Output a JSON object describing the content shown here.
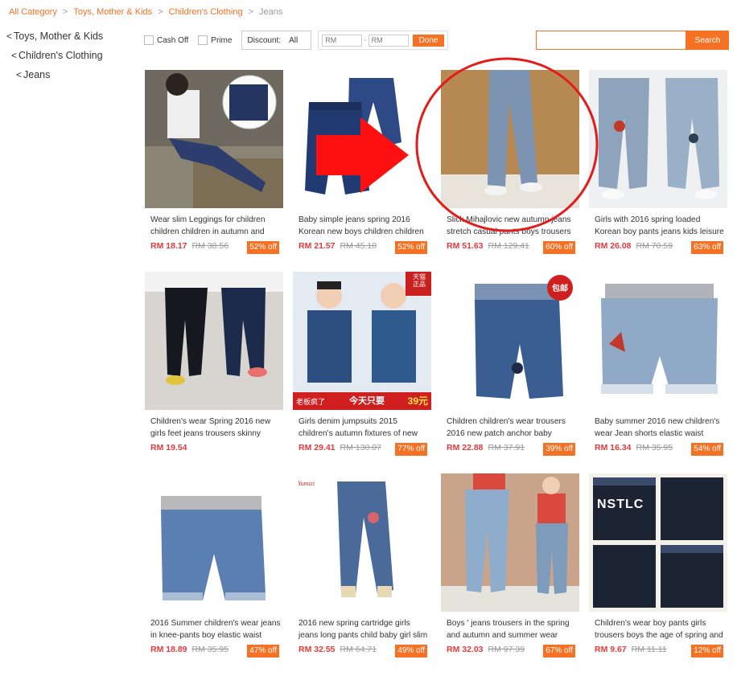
{
  "breadcrumb": [
    {
      "label": "All Category",
      "link": true
    },
    {
      "label": "Toys, Mother & Kids",
      "link": true
    },
    {
      "label": "Children's Clothing",
      "link": true
    },
    {
      "label": "Jeans",
      "link": false
    }
  ],
  "breadcrumb_sep": ">",
  "categories": [
    {
      "label": "Toys, Mother & Kids",
      "chevron": "<"
    },
    {
      "label": "Children's Clothing",
      "chevron": "<"
    },
    {
      "label": "Jeans",
      "chevron": "<"
    }
  ],
  "filters": {
    "cash_off_label": "Cash Off",
    "prime_label": "Prime",
    "discount_label": "Discount:",
    "discount_value": "All",
    "min_placeholder": "RM",
    "max_placeholder": "RM",
    "range_dash": "-",
    "done_label": "Done"
  },
  "search": {
    "placeholder": "",
    "button_label": "Search"
  },
  "accent_color": "#f57224",
  "price_color": "#e4393c",
  "products": [
    {
      "title": "Wear slim Leggings for children children children in autumn and",
      "price": "RM 18.17",
      "old_price": "RM 38.56",
      "discount": "52% off",
      "image": "girl-jeans-photo"
    },
    {
      "title": "Baby simple jeans spring 2016 Korean new boys children children",
      "price": "RM 21.57",
      "old_price": "RM 45.10",
      "discount": "52% off",
      "image": "baby-jeans-photo"
    },
    {
      "title": "Slick Mihajlovic new autumn jeans stretch casual pants boys trousers",
      "price": "RM 51.63",
      "old_price": "RM 129.41",
      "discount": "60% off",
      "image": "slim-jeans-photo"
    },
    {
      "title": "Girls with 2016 spring loaded Korean boy pants jeans kids leisure",
      "price": "RM 26.08",
      "old_price": "RM 70.59",
      "discount": "63% off",
      "image": "patch-jeans-photo"
    },
    {
      "title": "Children's wear Spring 2016 new girls feet jeans trousers skinny",
      "price": "RM 19.54",
      "old_price": "",
      "discount": "",
      "image": "dark-jeans-photo"
    },
    {
      "title": "Girls denim jumpsuits 2015 children's autumn fixtures of new",
      "price": "RM 29.41",
      "old_price": "RM 130.07",
      "discount": "77% off",
      "image": "denim-jumpsuit-photo",
      "badge_top": "天猫正品",
      "banner_left": "老板疯了",
      "banner_right": "今天只要",
      "banner_price": "39元"
    },
    {
      "title": "Children children's wear trousers 2016 new patch anchor baby",
      "price": "RM 22.88",
      "old_price": "RM 37.91",
      "discount": "39% off",
      "image": "anchor-jeans-photo",
      "sticker": "包邮"
    },
    {
      "title": "Baby summer 2016 new children's wear Jean shorts elastic waist",
      "price": "RM 16.34",
      "old_price": "RM 35.95",
      "discount": "54% off",
      "image": "jean-shorts-photo"
    },
    {
      "title": "2016 Summer children's wear jeans in knee-pants boy elastic waist",
      "price": "RM 18.89",
      "old_price": "RM 35.95",
      "discount": "47% off",
      "image": "knee-jeans-photo"
    },
    {
      "title": "2016 new spring cartridge girls jeans long pants child baby girl slim",
      "price": "RM 32.55",
      "old_price": "RM 64.71",
      "discount": "49% off",
      "image": "cartoon-jeans-photo",
      "logo": "Yumizi"
    },
    {
      "title": "Boys ' jeans trousers in the spring and autumn and summer wear",
      "price": "RM 32.03",
      "old_price": "RM 97.39",
      "discount": "67% off",
      "image": "boys-jeans-photo"
    },
    {
      "title": "Children's wear boy pants girls trousers boys the age of spring and",
      "price": "RM 9.67",
      "old_price": "RM 11.11",
      "discount": "12% off",
      "image": "harem-pants-photo",
      "print": "NSTLC"
    }
  ]
}
